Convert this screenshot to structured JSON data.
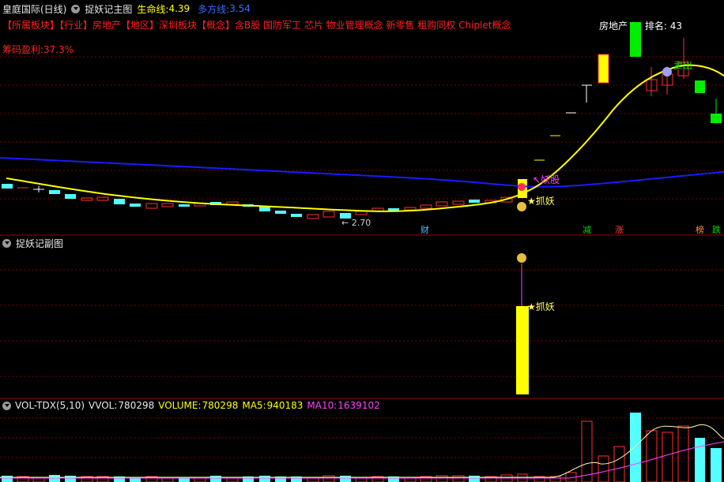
{
  "main": {
    "title": "皇庭国际(日线)",
    "indicator_name": "捉妖记主图",
    "life_line_label": "生命线:",
    "life_line_value": "4.39",
    "multi_line_label": "多方线:",
    "multi_line_value": "3.54",
    "sector_line": "【所属板块】【行业】房地产【地区】深圳板块【概念】含B股 国防军工 芯片 物业管理概念 新零售 租购同权 Chiplet概念",
    "profit_text": "筹码盈利:37.3%",
    "rank_sector": "房地产",
    "rank_label": "排名:",
    "rank_value": "43",
    "low_price": "2.70",
    "sell_label": "卖出",
    "yao_label": "妖股",
    "zhua_label": "抓妖",
    "event_markers": [
      "财",
      "减",
      "涨",
      "榜",
      "跌"
    ],
    "colors": {
      "life_line": "#ffff00",
      "multi_line": "#0000ff",
      "up": "#ff3030",
      "down": "#54ffff"
    }
  },
  "sub": {
    "indicator_name": "捉妖记副图",
    "zhua_label": "抓妖",
    "bag_icon": "money-bag-icon"
  },
  "volume": {
    "indicator_name": "VOL-TDX(5,10)",
    "vvol_label": "VVOL:",
    "vvol_value": "780298",
    "volume_label": "VOLUME:",
    "volume_value": "780298",
    "ma5_label": "MA5:",
    "ma5_value": "940183",
    "ma10_label": "MA10:",
    "ma10_value": "1639102"
  }
}
